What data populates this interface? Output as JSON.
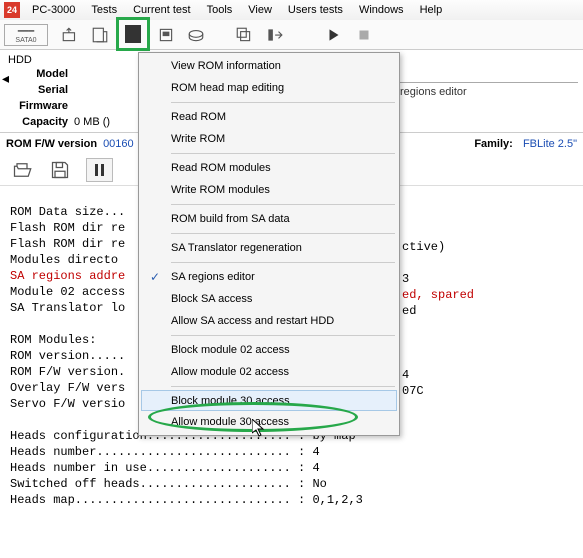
{
  "menubar": {
    "items": [
      "PC-3000",
      "Tests",
      "Current test",
      "Tools",
      "View",
      "Users tests",
      "Windows",
      "Help"
    ]
  },
  "toolbar": {
    "sata_label": "SATA0"
  },
  "info": {
    "hdd": "HDD",
    "labels": {
      "model": "Model",
      "serial": "Serial",
      "firmware": "Firmware",
      "capacity": "Capacity"
    },
    "capacity_value": "0 MB ()"
  },
  "regions_editor": "regions editor",
  "romfw": {
    "label": "ROM F/W version",
    "value": "00160",
    "family_label": "Family:",
    "family_value": "FBLite 2.5\""
  },
  "dropdown": {
    "items": [
      "View ROM information",
      "ROM head map editing",
      "Read ROM",
      "Write ROM",
      "Read ROM modules",
      "Write ROM modules",
      "ROM build from SA data",
      "SA Translator regeneration",
      "SA regions editor",
      "Block SA access",
      "Allow SA access and restart HDD",
      "Block module 02 access",
      "Allow module 02 access",
      "Block module 30 access",
      "Allow module 30 access"
    ],
    "checked_index": 8,
    "hover_index": 13
  },
  "mono": {
    "l01": "ROM Data size...",
    "l02": "Flash ROM dir re",
    "l03": "Flash ROM dir re",
    "l04": "Modules directo",
    "l05": "SA regions addre",
    "l06": "Module 02 access",
    "l07": "SA Translator lo",
    "l08": "",
    "l09": "ROM Modules:",
    "l10": "ROM version.....",
    "l11": "ROM F/W version.",
    "l12": "Overlay F/W vers",
    "l13": "Servo F/W versio",
    "l14": "",
    "l15": "Heads configuration.................... : by map",
    "l16": "Heads number........................... : 4",
    "l17": "Heads number in use.................... : 4",
    "l18": "Switched off heads..................... : No",
    "l19": "Heads map.............................. : 0,1,2,3"
  },
  "fragments": {
    "f1": "ctive)",
    "f2": "3",
    "f3": "ed, spared",
    "f4": "ed",
    "f5": "4",
    "f6": "07C"
  }
}
